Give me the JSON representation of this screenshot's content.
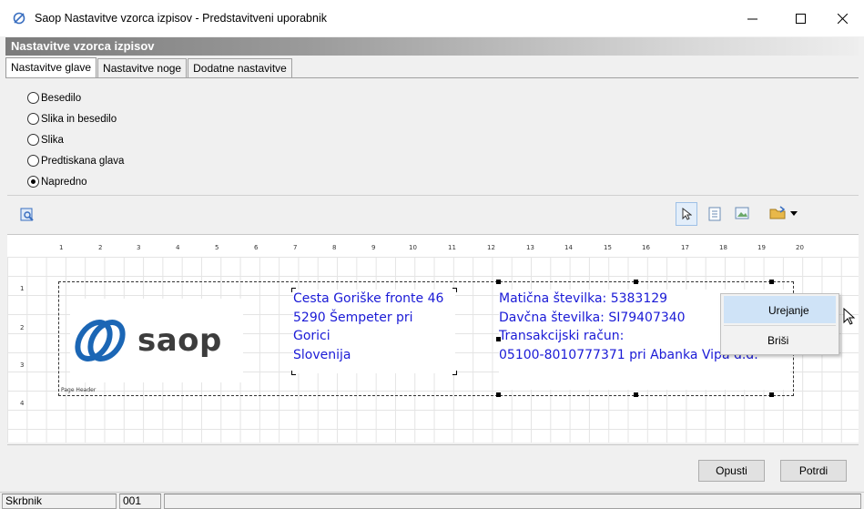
{
  "window": {
    "title": "Saop Nastavitve vzorca izpisov - Predstavitveni uporabnik",
    "minimize": "—",
    "maximize": "☐",
    "close": "✕"
  },
  "header": {
    "title": "Nastavitve vzorca izpisov"
  },
  "tabs": [
    {
      "label": "Nastavitve glave",
      "active": true
    },
    {
      "label": "Nastavitve noge",
      "active": false
    },
    {
      "label": "Dodatne nastavitve",
      "active": false
    }
  ],
  "radios": [
    {
      "label": "Besedilo",
      "checked": false
    },
    {
      "label": "Slika in besedilo",
      "checked": false
    },
    {
      "label": "Slika",
      "checked": false
    },
    {
      "label": "Predtiskana glava",
      "checked": false
    },
    {
      "label": "Napredno",
      "checked": true
    }
  ],
  "toolbar": {
    "icons": [
      "preview-icon",
      "pointer-tool-icon",
      "text-tool-icon",
      "image-tool-icon",
      "open-folder-icon",
      "dropdown-arrow-icon"
    ]
  },
  "designer": {
    "ruler_top": [
      "1",
      "2",
      "3",
      "4",
      "5",
      "6",
      "7",
      "8",
      "9",
      "10",
      "11",
      "12",
      "13",
      "14",
      "15",
      "16",
      "17",
      "18",
      "19",
      "20"
    ],
    "ruler_left": [
      "1",
      "2",
      "3",
      "4"
    ],
    "band_label": "Page Header",
    "logo_text": "saop",
    "address": [
      "Cesta Goriške fronte 46",
      "5290 Šempeter pri",
      "Gorici",
      "Slovenija"
    ],
    "info": [
      "Matična številka: 5383129",
      "Davčna številka: SI79407340",
      "Transakcijski račun:",
      "05100-8010777371 pri Abanka Vipa d.d."
    ],
    "text_color": "#1a1ad6"
  },
  "context_menu": {
    "items": [
      {
        "label": "Urejanje",
        "highlighted": true
      },
      {
        "label": "Briši",
        "highlighted": false
      }
    ]
  },
  "buttons": {
    "cancel": "Opusti",
    "confirm": "Potrdi"
  },
  "status": {
    "user": "Skrbnik",
    "code": "001"
  }
}
